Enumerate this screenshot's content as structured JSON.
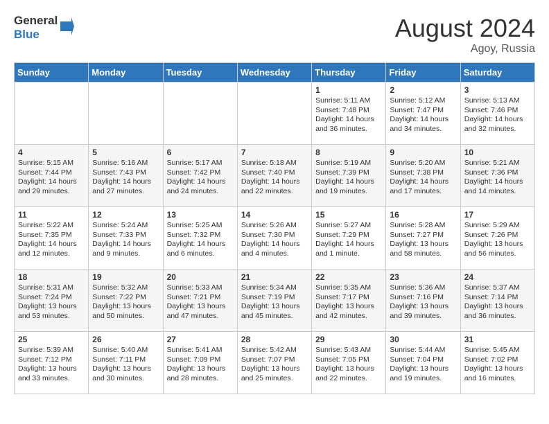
{
  "header": {
    "logo_line1": "General",
    "logo_line2": "Blue",
    "month_year": "August 2024",
    "location": "Agoy, Russia"
  },
  "days_of_week": [
    "Sunday",
    "Monday",
    "Tuesday",
    "Wednesday",
    "Thursday",
    "Friday",
    "Saturday"
  ],
  "weeks": [
    [
      {
        "day": "",
        "info": ""
      },
      {
        "day": "",
        "info": ""
      },
      {
        "day": "",
        "info": ""
      },
      {
        "day": "",
        "info": ""
      },
      {
        "day": "1",
        "info": "Sunrise: 5:11 AM\nSunset: 7:48 PM\nDaylight: 14 hours\nand 36 minutes."
      },
      {
        "day": "2",
        "info": "Sunrise: 5:12 AM\nSunset: 7:47 PM\nDaylight: 14 hours\nand 34 minutes."
      },
      {
        "day": "3",
        "info": "Sunrise: 5:13 AM\nSunset: 7:46 PM\nDaylight: 14 hours\nand 32 minutes."
      }
    ],
    [
      {
        "day": "4",
        "info": "Sunrise: 5:15 AM\nSunset: 7:44 PM\nDaylight: 14 hours\nand 29 minutes."
      },
      {
        "day": "5",
        "info": "Sunrise: 5:16 AM\nSunset: 7:43 PM\nDaylight: 14 hours\nand 27 minutes."
      },
      {
        "day": "6",
        "info": "Sunrise: 5:17 AM\nSunset: 7:42 PM\nDaylight: 14 hours\nand 24 minutes."
      },
      {
        "day": "7",
        "info": "Sunrise: 5:18 AM\nSunset: 7:40 PM\nDaylight: 14 hours\nand 22 minutes."
      },
      {
        "day": "8",
        "info": "Sunrise: 5:19 AM\nSunset: 7:39 PM\nDaylight: 14 hours\nand 19 minutes."
      },
      {
        "day": "9",
        "info": "Sunrise: 5:20 AM\nSunset: 7:38 PM\nDaylight: 14 hours\nand 17 minutes."
      },
      {
        "day": "10",
        "info": "Sunrise: 5:21 AM\nSunset: 7:36 PM\nDaylight: 14 hours\nand 14 minutes."
      }
    ],
    [
      {
        "day": "11",
        "info": "Sunrise: 5:22 AM\nSunset: 7:35 PM\nDaylight: 14 hours\nand 12 minutes."
      },
      {
        "day": "12",
        "info": "Sunrise: 5:24 AM\nSunset: 7:33 PM\nDaylight: 14 hours\nand 9 minutes."
      },
      {
        "day": "13",
        "info": "Sunrise: 5:25 AM\nSunset: 7:32 PM\nDaylight: 14 hours\nand 6 minutes."
      },
      {
        "day": "14",
        "info": "Sunrise: 5:26 AM\nSunset: 7:30 PM\nDaylight: 14 hours\nand 4 minutes."
      },
      {
        "day": "15",
        "info": "Sunrise: 5:27 AM\nSunset: 7:29 PM\nDaylight: 14 hours\nand 1 minute."
      },
      {
        "day": "16",
        "info": "Sunrise: 5:28 AM\nSunset: 7:27 PM\nDaylight: 13 hours\nand 58 minutes."
      },
      {
        "day": "17",
        "info": "Sunrise: 5:29 AM\nSunset: 7:26 PM\nDaylight: 13 hours\nand 56 minutes."
      }
    ],
    [
      {
        "day": "18",
        "info": "Sunrise: 5:31 AM\nSunset: 7:24 PM\nDaylight: 13 hours\nand 53 minutes."
      },
      {
        "day": "19",
        "info": "Sunrise: 5:32 AM\nSunset: 7:22 PM\nDaylight: 13 hours\nand 50 minutes."
      },
      {
        "day": "20",
        "info": "Sunrise: 5:33 AM\nSunset: 7:21 PM\nDaylight: 13 hours\nand 47 minutes."
      },
      {
        "day": "21",
        "info": "Sunrise: 5:34 AM\nSunset: 7:19 PM\nDaylight: 13 hours\nand 45 minutes."
      },
      {
        "day": "22",
        "info": "Sunrise: 5:35 AM\nSunset: 7:17 PM\nDaylight: 13 hours\nand 42 minutes."
      },
      {
        "day": "23",
        "info": "Sunrise: 5:36 AM\nSunset: 7:16 PM\nDaylight: 13 hours\nand 39 minutes."
      },
      {
        "day": "24",
        "info": "Sunrise: 5:37 AM\nSunset: 7:14 PM\nDaylight: 13 hours\nand 36 minutes."
      }
    ],
    [
      {
        "day": "25",
        "info": "Sunrise: 5:39 AM\nSunset: 7:12 PM\nDaylight: 13 hours\nand 33 minutes."
      },
      {
        "day": "26",
        "info": "Sunrise: 5:40 AM\nSunset: 7:11 PM\nDaylight: 13 hours\nand 30 minutes."
      },
      {
        "day": "27",
        "info": "Sunrise: 5:41 AM\nSunset: 7:09 PM\nDaylight: 13 hours\nand 28 minutes."
      },
      {
        "day": "28",
        "info": "Sunrise: 5:42 AM\nSunset: 7:07 PM\nDaylight: 13 hours\nand 25 minutes."
      },
      {
        "day": "29",
        "info": "Sunrise: 5:43 AM\nSunset: 7:05 PM\nDaylight: 13 hours\nand 22 minutes."
      },
      {
        "day": "30",
        "info": "Sunrise: 5:44 AM\nSunset: 7:04 PM\nDaylight: 13 hours\nand 19 minutes."
      },
      {
        "day": "31",
        "info": "Sunrise: 5:45 AM\nSunset: 7:02 PM\nDaylight: 13 hours\nand 16 minutes."
      }
    ]
  ]
}
